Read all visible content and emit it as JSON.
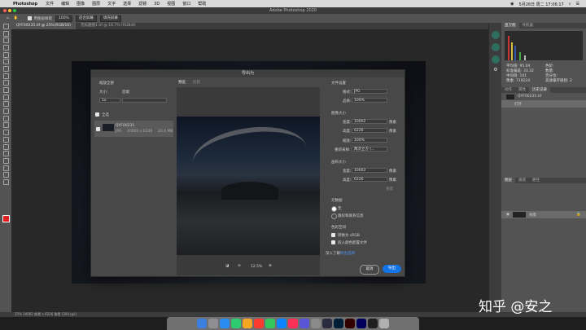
{
  "menubar": {
    "app": "Photoshop",
    "items": [
      "文件",
      "编辑",
      "图像",
      "图层",
      "文字",
      "选择",
      "滤镜",
      "3D",
      "视图",
      "窗口",
      "帮助"
    ],
    "clock": "5月26日 周二 17:06:17"
  },
  "window_title": "Adobe Photoshop 2020",
  "options_bar": {
    "sample_label": "用图层样取",
    "zoom_value": "100%",
    "fit_screen": "适合屏幕",
    "fill_screen": "填充屏幕"
  },
  "doc_tabs": [
    {
      "label": "QYF00235.tif @ 25%(RGB/16)"
    },
    {
      "label": "无标题图1.tif @ 16.7% (RGB/8)"
    }
  ],
  "right_panel": {
    "top_tabs": [
      "直方图",
      "导航器"
    ],
    "stats": [
      [
        "平均值:",
        "95.04"
      ],
      [
        "色阶:",
        ""
      ],
      [
        "标准偏差:",
        "33.32"
      ],
      [
        "数量:",
        ""
      ],
      [
        "中间值:",
        "101"
      ],
      [
        "百分位:",
        ""
      ],
      [
        "像素:",
        "719224"
      ],
      [
        "高速缓存级别:",
        "2"
      ]
    ],
    "history_tabs": [
      "动作",
      "属性",
      "历史记录"
    ],
    "history_items": [
      "QYF00235.tif",
      "打开"
    ],
    "layer_tabs": [
      "图层",
      "通道",
      "路径"
    ],
    "layer_name": "背景"
  },
  "status_bar": "25%   10002 像素 x 6226 像素 (300 ppi)",
  "dialog": {
    "title": "导出为",
    "scale_all_label": "缩放全部",
    "size_label": "大小:",
    "suffix_label": "后缀",
    "size_value": "1x",
    "select_all": "全选",
    "asset_name": "QYF00235",
    "asset_format": "JPG",
    "asset_dims": "10002 x 6226",
    "asset_size": "20.4 MB",
    "preview_tabs": [
      "预览",
      "比较"
    ],
    "zoom_value": "12.5%",
    "file_settings": "文件设置",
    "format_label": "格式:",
    "format_value": "JPG",
    "quality_label": "品质:",
    "quality_value": "100%",
    "image_size": "图像大小",
    "width_label": "宽度:",
    "width_value": "10002",
    "height_label": "高度:",
    "height_value": "6226",
    "unit": "像素",
    "scale_label": "缩放:",
    "scale_value": "100%",
    "resample_label": "重新采样:",
    "resample_value": "两次立方 (...",
    "canvas_size": "画布大小",
    "canvas_width": "10002",
    "canvas_height": "6226",
    "reset_label": "重置",
    "metadata": "元数据",
    "meta_none": "无",
    "meta_copyright": "版权和联系信息",
    "color_space": "色彩空间",
    "convert_srgb": "转换为 sRGB",
    "embed_profile": "嵌入颜色配置文件",
    "learn_more": "深入了解:",
    "export_options": "导出选项",
    "cancel": "取消",
    "export": "导出"
  },
  "watermark": "知乎 @安之"
}
